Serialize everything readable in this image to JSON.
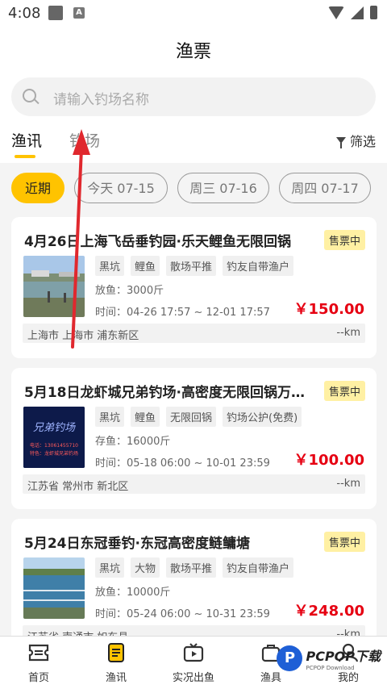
{
  "status_bar": {
    "time": "4:08",
    "icon_a": "A"
  },
  "header": {
    "title": "渔票"
  },
  "search": {
    "placeholder": "请输入钓场名称"
  },
  "tabs": [
    {
      "label": "渔讯",
      "active": true
    },
    {
      "label": "钓场",
      "active": false
    }
  ],
  "filter": {
    "label": "筛选"
  },
  "date_chips": [
    {
      "label": "近期",
      "active": true
    },
    {
      "label": "今天 07-15"
    },
    {
      "label": "周三 07-16"
    },
    {
      "label": "周四 07-17"
    }
  ],
  "cards": [
    {
      "title": "4月26日上海飞岳垂钓园·乐天鲤鱼无限回锅",
      "badge": "售票中",
      "tags": [
        "黑坑",
        "鲤鱼",
        "散场平推",
        "钓友自带渔户"
      ],
      "stock": "放鱼：3000斤",
      "time": "时间：04-26 17:57 ~ 12-01 17:57",
      "price": "￥150.00",
      "location": "上海市 上海市 浦东新区",
      "distance": "--km"
    },
    {
      "title": "5月18日龙虾城兄弟钓场·高密度无限回锅万斤…",
      "badge": "售票中",
      "tags": [
        "黑坑",
        "鲤鱼",
        "无限回锅",
        "钓场公护(免费)"
      ],
      "stock": "存鱼：16000斤",
      "time": "时间：05-18 06:00 ~ 10-01 23:59",
      "price": "￥100.00",
      "location": "江苏省 常州市 新北区",
      "distance": "--km",
      "thumb_text": "兄弟钓场",
      "thumb_line1": "电话：13061455710",
      "thumb_line2": "特色：龙虾城兄弟钓场"
    },
    {
      "title": "5月24日东冠垂钓·东冠高密度鲢鳙塘",
      "badge": "售票中",
      "tags": [
        "黑坑",
        "大物",
        "散场平推",
        "钓友自带渔户"
      ],
      "stock": "放鱼：10000斤",
      "time": "时间：05-24 06:00 ~ 10-31 23:59",
      "price": "￥248.00",
      "location": "江苏省 南通市 如东县",
      "distance": "--km"
    }
  ],
  "bottom_nav": [
    {
      "label": "首页",
      "icon": "ticket-icon"
    },
    {
      "label": "渔讯",
      "icon": "document-icon",
      "active": true
    },
    {
      "label": "实况出鱼",
      "icon": "tv-icon"
    },
    {
      "label": "渔具",
      "icon": "bag-icon"
    },
    {
      "label": "我的",
      "icon": "user-icon"
    }
  ],
  "watermark": {
    "logo": "P",
    "text": "PCPOP下载",
    "sub": "PCPOP Download"
  },
  "colors": {
    "accent": "#ffc300",
    "price": "#e60012",
    "badge_bg": "#fff0a3",
    "arrow": "#e0282e"
  }
}
